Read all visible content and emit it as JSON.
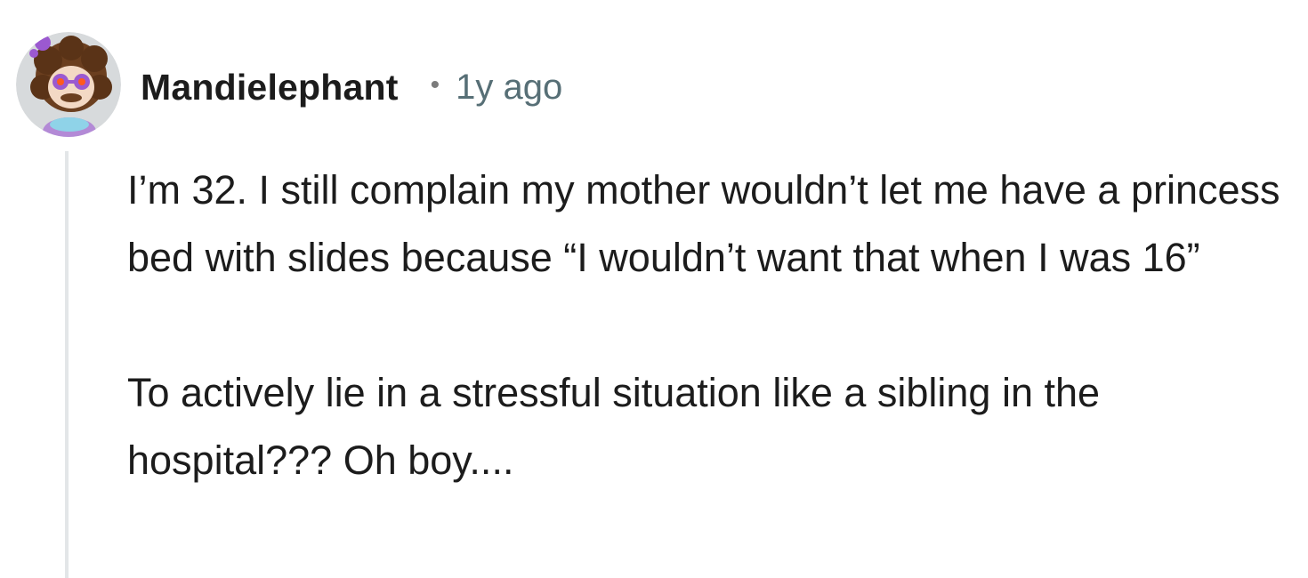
{
  "comment": {
    "author": {
      "username": "Mandielephant",
      "avatar_icon": "snoo-avatar-icon"
    },
    "separator": "•",
    "timestamp": "1y ago",
    "paragraphs": [
      "I’m 32. I still complain my mother wouldn’t let me have a princess bed with slides because “I wouldn’t want that when I was 16”",
      "To actively lie in a stressful situation like a sibling in the hospital??? Oh boy...."
    ]
  },
  "colors": {
    "username": "#1c1c1c",
    "timestamp": "#576f76",
    "body_text": "#1c1c1c",
    "thread_line": "#e3e6e8",
    "avatar_background": "#d7dadc"
  }
}
